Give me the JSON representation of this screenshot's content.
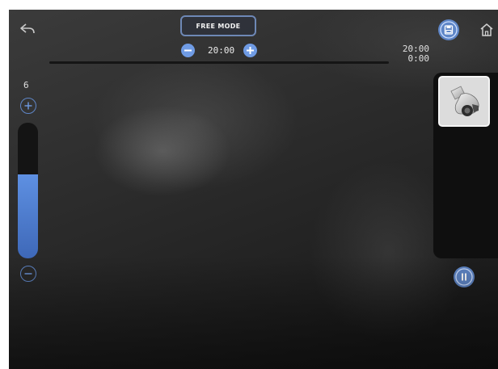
{
  "header": {
    "back_icon": "back-arrow-icon",
    "mode_label": "FREE MODE",
    "timer": "20:00",
    "decrease_icon": "minus-circle-icon",
    "increase_icon": "plus-circle-icon",
    "save_icon": "floppy-disk-icon",
    "home_icon": "home-icon"
  },
  "session": {
    "total_time": "20:00",
    "elapsed_time": "0:00",
    "progress": 0
  },
  "intensity": {
    "value": "6",
    "level_fraction": 0.62,
    "increase_icon": "plus-circle-icon",
    "decrease_icon": "minus-circle-icon"
  },
  "device": {
    "icon": "massager-device-icon"
  },
  "controls": {
    "pause_icon": "pause-icon"
  },
  "colors": {
    "accent": "#6f9be4",
    "background": "#2a2a2a"
  }
}
